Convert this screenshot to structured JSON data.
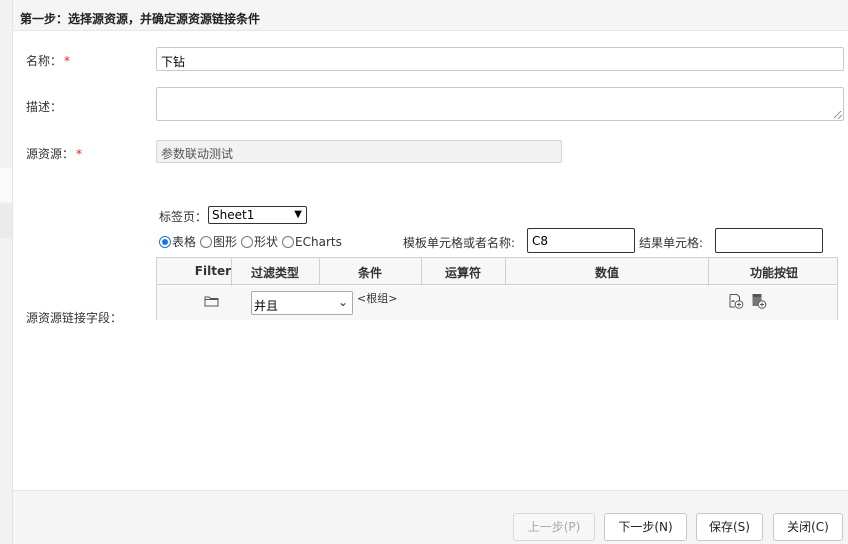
{
  "header": {
    "title": "第一步：选择源资源，并确定源资源链接条件"
  },
  "form": {
    "name": {
      "label": "名称：",
      "required_mark": "*",
      "value": "下钻"
    },
    "description": {
      "label": "描述：",
      "value": ""
    },
    "source": {
      "label": "源资源：",
      "required_mark": "*",
      "value": "参数联动测试"
    },
    "link_fields": {
      "label": "源资源链接字段："
    }
  },
  "sheet": {
    "label": "标签页：",
    "selected": "Sheet1"
  },
  "radios": [
    {
      "label": "表格",
      "checked": true
    },
    {
      "label": "图形",
      "checked": false
    },
    {
      "label": "形状",
      "checked": false
    },
    {
      "label": "ECharts",
      "checked": false
    }
  ],
  "template_cell": {
    "label": "模板单元格或者名称:",
    "value": "C8"
  },
  "result_cell": {
    "label": "结果单元格:",
    "value": ""
  },
  "grid": {
    "headers": [
      "Filter",
      "过滤类型",
      "条件",
      "运算符",
      "数值",
      "功能按钮"
    ],
    "row": {
      "logic": "并且",
      "group": "<根组>"
    }
  },
  "icons": {
    "folder": "folder-icon",
    "add_condition": "add-condition-icon",
    "add_group": "add-group-icon"
  },
  "footer": {
    "prev": "上一步(P)",
    "next": "下一步(N)",
    "save": "保存(S)",
    "close": "关闭(C)"
  }
}
